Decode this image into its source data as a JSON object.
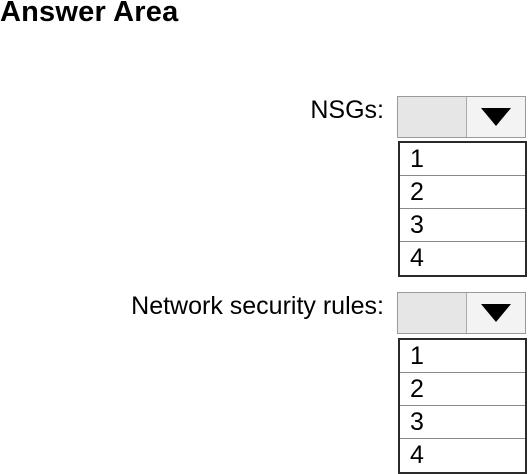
{
  "title": "Answer Area",
  "fields": [
    {
      "label": "NSGs:",
      "selected_value": "",
      "arrow_icon": "down-triangle-icon",
      "options": [
        "1",
        "2",
        "3",
        "4"
      ]
    },
    {
      "label": "Network security rules:",
      "selected_value": "",
      "arrow_icon": "down-triangle-icon",
      "options": [
        "1",
        "2",
        "3",
        "4"
      ]
    }
  ]
}
